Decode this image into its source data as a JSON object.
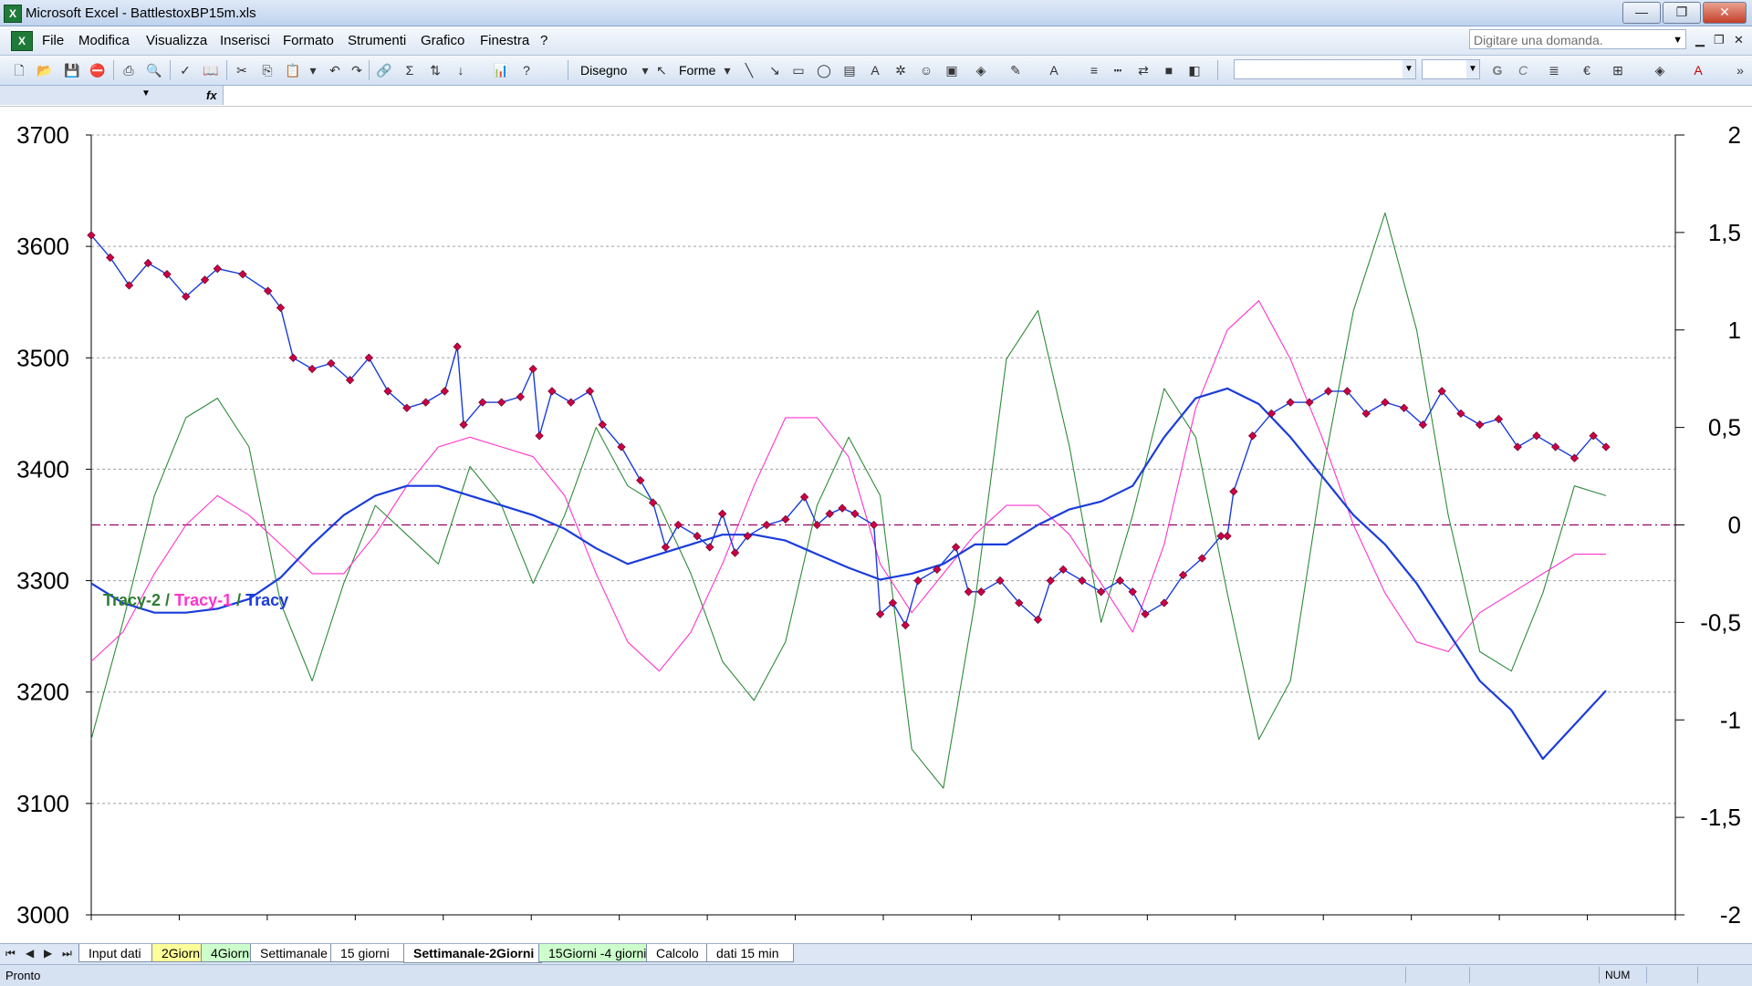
{
  "window": {
    "title": "Microsoft Excel - BattlestoxBP15m.xls",
    "app_icon": "excel-icon"
  },
  "menu": {
    "items": [
      "File",
      "Modifica",
      "Visualizza",
      "Inserisci",
      "Formato",
      "Strumenti",
      "Grafico",
      "Finestra",
      "?"
    ],
    "help_placeholder": "Digitare una domanda."
  },
  "toolbar": {
    "draw_label": "Disegno",
    "shapes_label": "Forme"
  },
  "formula_bar": {
    "fx": "fx"
  },
  "sheet_tabs": {
    "tabs": [
      "Input dati",
      "2Giorni",
      "4Giorni",
      "Settimanale",
      "15 giorni",
      "Settimanale-2Giorni",
      "15Giorni -4 giorni",
      "Calcolo",
      "dati 15 min"
    ],
    "active": "Settimanale-2Giorni",
    "colors": {
      "2Giorni": "#ffff99",
      "4Giorni": "#ccffcc",
      "15Giorni -4 giorni": "#ccffcc"
    }
  },
  "status": {
    "text": "Pronto",
    "num": "NUM"
  },
  "chart_data": {
    "type": "line",
    "legend_text": [
      {
        "text": "Tracy-2",
        "color": "#2e7d32"
      },
      {
        "text": " / ",
        "color": "#2e7d32"
      },
      {
        "text": "Tracy-1",
        "color": "#ff33cc"
      },
      {
        "text": " / ",
        "color": "#2e7d32"
      },
      {
        "text": "Tracy",
        "color": "#1a3cdc"
      }
    ],
    "y_left": {
      "min": 3000,
      "max": 3700,
      "step": 100,
      "ticks": [
        "3000",
        "3100",
        "3200",
        "3300",
        "3400",
        "3500",
        "3600",
        "3700"
      ]
    },
    "y_right": {
      "min": -2,
      "max": 2,
      "step": 0.5,
      "ticks": [
        "-2",
        "-1,5",
        "-1",
        "-0,5",
        "0",
        "0,5",
        "1",
        "1,5",
        "2"
      ]
    },
    "gridlines": true,
    "x_count": 18,
    "series": [
      {
        "axis": "left",
        "color": "#1a3cdc",
        "marker_color": "#cc0044",
        "role": "price",
        "values": [
          [
            0,
            3610
          ],
          [
            0.3,
            3590
          ],
          [
            0.6,
            3565
          ],
          [
            0.9,
            3585
          ],
          [
            1.2,
            3575
          ],
          [
            1.5,
            3555
          ],
          [
            1.8,
            3570
          ],
          [
            2.0,
            3580
          ],
          [
            2.4,
            3575
          ],
          [
            2.8,
            3560
          ],
          [
            3.0,
            3545
          ],
          [
            3.2,
            3500
          ],
          [
            3.5,
            3490
          ],
          [
            3.8,
            3495
          ],
          [
            4.1,
            3480
          ],
          [
            4.4,
            3500
          ],
          [
            4.7,
            3470
          ],
          [
            5.0,
            3455
          ],
          [
            5.3,
            3460
          ],
          [
            5.6,
            3470
          ],
          [
            5.8,
            3510
          ],
          [
            5.9,
            3440
          ],
          [
            6.2,
            3460
          ],
          [
            6.5,
            3460
          ],
          [
            6.8,
            3465
          ],
          [
            7.0,
            3490
          ],
          [
            7.1,
            3430
          ],
          [
            7.3,
            3470
          ],
          [
            7.6,
            3460
          ],
          [
            7.9,
            3470
          ],
          [
            8.1,
            3440
          ],
          [
            8.4,
            3420
          ],
          [
            8.7,
            3390
          ],
          [
            8.9,
            3370
          ],
          [
            9.1,
            3330
          ],
          [
            9.3,
            3350
          ],
          [
            9.6,
            3340
          ],
          [
            9.8,
            3330
          ],
          [
            10.0,
            3360
          ],
          [
            10.2,
            3325
          ],
          [
            10.4,
            3340
          ],
          [
            10.7,
            3350
          ],
          [
            11.0,
            3355
          ],
          [
            11.3,
            3375
          ],
          [
            11.5,
            3350
          ],
          [
            11.7,
            3360
          ],
          [
            11.9,
            3365
          ],
          [
            12.1,
            3360
          ],
          [
            12.4,
            3350
          ],
          [
            12.5,
            3270
          ],
          [
            12.7,
            3280
          ],
          [
            12.9,
            3260
          ],
          [
            13.1,
            3300
          ],
          [
            13.4,
            3310
          ],
          [
            13.7,
            3330
          ],
          [
            13.9,
            3290
          ],
          [
            14.1,
            3290
          ],
          [
            14.4,
            3300
          ],
          [
            14.7,
            3280
          ],
          [
            15.0,
            3265
          ],
          [
            15.2,
            3300
          ],
          [
            15.4,
            3310
          ],
          [
            15.7,
            3300
          ],
          [
            16.0,
            3290
          ],
          [
            16.3,
            3300
          ],
          [
            16.5,
            3290
          ],
          [
            16.7,
            3270
          ],
          [
            17.0,
            3280
          ],
          [
            17.3,
            3305
          ],
          [
            17.6,
            3320
          ],
          [
            17.9,
            3340
          ],
          [
            18.0,
            3340
          ],
          [
            18.1,
            3380
          ],
          [
            18.4,
            3430
          ],
          [
            18.7,
            3450
          ],
          [
            19.0,
            3460
          ],
          [
            19.3,
            3460
          ],
          [
            19.6,
            3470
          ],
          [
            19.9,
            3470
          ],
          [
            20.2,
            3450
          ],
          [
            20.5,
            3460
          ],
          [
            20.8,
            3455
          ],
          [
            21.1,
            3440
          ],
          [
            21.4,
            3470
          ],
          [
            21.7,
            3450
          ],
          [
            22.0,
            3440
          ],
          [
            22.3,
            3445
          ],
          [
            22.6,
            3420
          ],
          [
            22.9,
            3430
          ],
          [
            23.2,
            3420
          ],
          [
            23.5,
            3410
          ],
          [
            23.8,
            3430
          ],
          [
            24.0,
            3420
          ]
        ]
      },
      {
        "axis": "right",
        "color": "#1a3cdc",
        "values": [
          [
            0,
            -0.3
          ],
          [
            0.5,
            -0.4
          ],
          [
            1,
            -0.45
          ],
          [
            1.5,
            -0.45
          ],
          [
            2,
            -0.43
          ],
          [
            2.5,
            -0.38
          ],
          [
            3,
            -0.27
          ],
          [
            3.5,
            -0.1
          ],
          [
            4,
            0.05
          ],
          [
            4.5,
            0.15
          ],
          [
            5,
            0.2
          ],
          [
            5.5,
            0.2
          ],
          [
            6,
            0.15
          ],
          [
            6.5,
            0.1
          ],
          [
            7,
            0.05
          ],
          [
            7.5,
            -0.02
          ],
          [
            8,
            -0.12
          ],
          [
            8.5,
            -0.2
          ],
          [
            9,
            -0.15
          ],
          [
            9.5,
            -0.1
          ],
          [
            10,
            -0.05
          ],
          [
            10.5,
            -0.05
          ],
          [
            11,
            -0.08
          ],
          [
            11.5,
            -0.15
          ],
          [
            12,
            -0.22
          ],
          [
            12.5,
            -0.28
          ],
          [
            13,
            -0.25
          ],
          [
            13.5,
            -0.2
          ],
          [
            14,
            -0.1
          ],
          [
            14.5,
            -0.1
          ],
          [
            15,
            0
          ],
          [
            15.5,
            0.08
          ],
          [
            16,
            0.12
          ],
          [
            16.5,
            0.2
          ],
          [
            17,
            0.45
          ],
          [
            17.5,
            0.65
          ],
          [
            18,
            0.7
          ],
          [
            18.5,
            0.62
          ],
          [
            19,
            0.45
          ],
          [
            19.5,
            0.25
          ],
          [
            20,
            0.05
          ],
          [
            20.5,
            -0.1
          ],
          [
            21,
            -0.3
          ],
          [
            21.5,
            -0.55
          ],
          [
            22,
            -0.8
          ],
          [
            22.5,
            -0.95
          ],
          [
            23,
            -1.2
          ],
          [
            24,
            -0.85
          ]
        ]
      },
      {
        "axis": "right",
        "color": "#ff33cc",
        "values": [
          [
            0,
            -0.7
          ],
          [
            0.5,
            -0.55
          ],
          [
            1,
            -0.25
          ],
          [
            1.5,
            0
          ],
          [
            2,
            0.15
          ],
          [
            2.5,
            0.05
          ],
          [
            3,
            -0.1
          ],
          [
            3.5,
            -0.25
          ],
          [
            4,
            -0.25
          ],
          [
            4.5,
            -0.05
          ],
          [
            5,
            0.2
          ],
          [
            5.5,
            0.4
          ],
          [
            6,
            0.45
          ],
          [
            6.5,
            0.4
          ],
          [
            7,
            0.35
          ],
          [
            7.5,
            0.15
          ],
          [
            8,
            -0.25
          ],
          [
            8.5,
            -0.6
          ],
          [
            9,
            -0.75
          ],
          [
            9.5,
            -0.55
          ],
          [
            10,
            -0.2
          ],
          [
            10.5,
            0.2
          ],
          [
            11,
            0.55
          ],
          [
            11.5,
            0.55
          ],
          [
            12,
            0.35
          ],
          [
            12.5,
            -0.2
          ],
          [
            13,
            -0.45
          ],
          [
            13.5,
            -0.25
          ],
          [
            14,
            -0.05
          ],
          [
            14.5,
            0.1
          ],
          [
            15,
            0.1
          ],
          [
            15.5,
            -0.05
          ],
          [
            16,
            -0.3
          ],
          [
            16.5,
            -0.55
          ],
          [
            17,
            -0.1
          ],
          [
            17.5,
            0.6
          ],
          [
            18,
            1.0
          ],
          [
            18.5,
            1.15
          ],
          [
            19,
            0.85
          ],
          [
            19.5,
            0.45
          ],
          [
            20,
            0
          ],
          [
            20.5,
            -0.35
          ],
          [
            21,
            -0.6
          ],
          [
            21.5,
            -0.65
          ],
          [
            22,
            -0.45
          ],
          [
            22.5,
            -0.35
          ],
          [
            23,
            -0.25
          ],
          [
            23.5,
            -0.15
          ],
          [
            24,
            -0.15
          ]
        ]
      },
      {
        "axis": "right",
        "color": "#2e8b3a",
        "values": [
          [
            0,
            -1.1
          ],
          [
            0.5,
            -0.5
          ],
          [
            1,
            0.15
          ],
          [
            1.5,
            0.55
          ],
          [
            2,
            0.65
          ],
          [
            2.5,
            0.4
          ],
          [
            3,
            -0.4
          ],
          [
            3.5,
            -0.8
          ],
          [
            4,
            -0.3
          ],
          [
            4.5,
            0.1
          ],
          [
            5,
            -0.05
          ],
          [
            5.5,
            -0.2
          ],
          [
            6,
            0.3
          ],
          [
            6.5,
            0.1
          ],
          [
            7,
            -0.3
          ],
          [
            7.5,
            0.05
          ],
          [
            8,
            0.5
          ],
          [
            8.5,
            0.2
          ],
          [
            9,
            0.1
          ],
          [
            9.5,
            -0.25
          ],
          [
            10,
            -0.7
          ],
          [
            10.5,
            -0.9
          ],
          [
            11,
            -0.6
          ],
          [
            11.5,
            0.1
          ],
          [
            12,
            0.45
          ],
          [
            12.5,
            0.15
          ],
          [
            13,
            -1.15
          ],
          [
            13.5,
            -1.35
          ],
          [
            14,
            -0.4
          ],
          [
            14.5,
            0.85
          ],
          [
            15,
            1.1
          ],
          [
            15.5,
            0.4
          ],
          [
            16,
            -0.5
          ],
          [
            16.5,
            0.05
          ],
          [
            17,
            0.7
          ],
          [
            17.5,
            0.45
          ],
          [
            18,
            -0.35
          ],
          [
            18.5,
            -1.1
          ],
          [
            19,
            -0.8
          ],
          [
            19.5,
            0.25
          ],
          [
            20,
            1.1
          ],
          [
            20.5,
            1.6
          ],
          [
            21,
            1.0
          ],
          [
            21.5,
            0.05
          ],
          [
            22,
            -0.65
          ],
          [
            22.5,
            -0.75
          ],
          [
            23,
            -0.35
          ],
          [
            23.5,
            0.2
          ],
          [
            24,
            0.15
          ]
        ]
      }
    ],
    "reference_line": {
      "axis": "right",
      "value": 0,
      "color": "#990066",
      "style": "dashdot"
    }
  }
}
